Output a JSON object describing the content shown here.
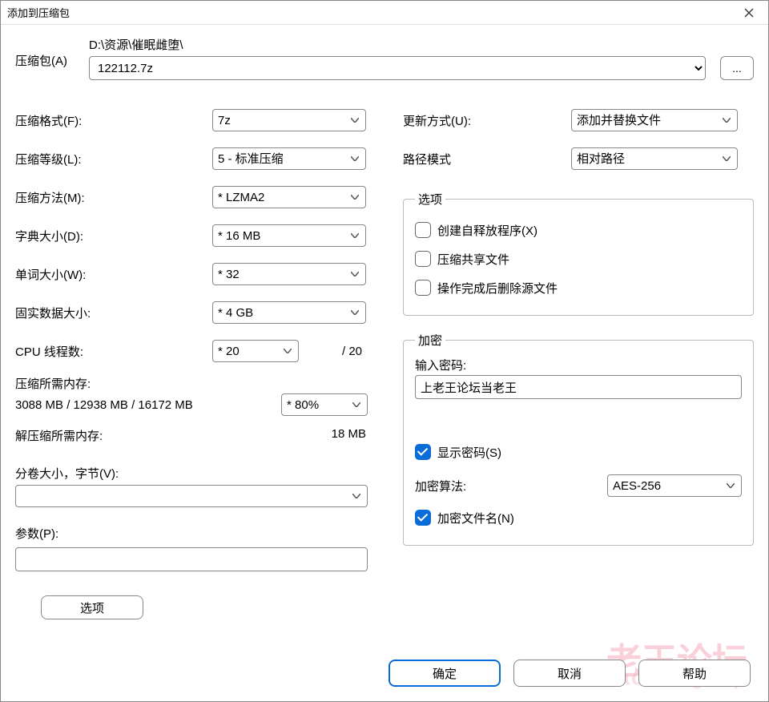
{
  "title": "添加到压缩包",
  "archive": {
    "label": "压缩包(A)",
    "path": "D:\\资源\\催眠雌堕\\",
    "filename": "122112.7z",
    "browse": "..."
  },
  "left": {
    "format_label": "压缩格式(F):",
    "format_value": "7z",
    "level_label": "压缩等级(L):",
    "level_value": "5 - 标准压缩",
    "method_label": "压缩方法(M):",
    "method_value": "* LZMA2",
    "dict_label": "字典大小(D):",
    "dict_value": "* 16 MB",
    "word_label": "单词大小(W):",
    "word_value": "* 32",
    "solid_label": "固实数据大小:",
    "solid_value": "* 4 GB",
    "cpu_label": "CPU 线程数:",
    "cpu_value": "* 20",
    "cpu_max": "/ 20",
    "mem_compress_label": "压缩所需内存:",
    "mem_text": "3088 MB / 12938 MB / 16172 MB",
    "mem_pct": "* 80%",
    "mem_decompress_label": "解压缩所需内存:",
    "mem_decompress_value": "18 MB",
    "split_label": "分卷大小，字节(V):",
    "split_value": "",
    "params_label": "参数(P):",
    "params_value": "",
    "option_button": "选项"
  },
  "right": {
    "update_label": "更新方式(U):",
    "update_value": "添加并替换文件",
    "pathmode_label": "路径模式",
    "pathmode_value": "相对路径",
    "options_legend": "选项",
    "opt_sfx": "创建自释放程序(X)",
    "opt_shared": "压缩共享文件",
    "opt_delete": "操作完成后删除源文件",
    "encrypt_legend": "加密",
    "pwd_label": "输入密码:",
    "pwd_value": "上老王论坛当老王",
    "show_pwd": "显示密码(S)",
    "algo_label": "加密算法:",
    "algo_value": "AES-256",
    "encrypt_names": "加密文件名(N)"
  },
  "buttons": {
    "ok": "确定",
    "cancel": "取消",
    "help": "帮助"
  },
  "watermark": "老王论坛",
  "watermark2": "laowang.vip"
}
